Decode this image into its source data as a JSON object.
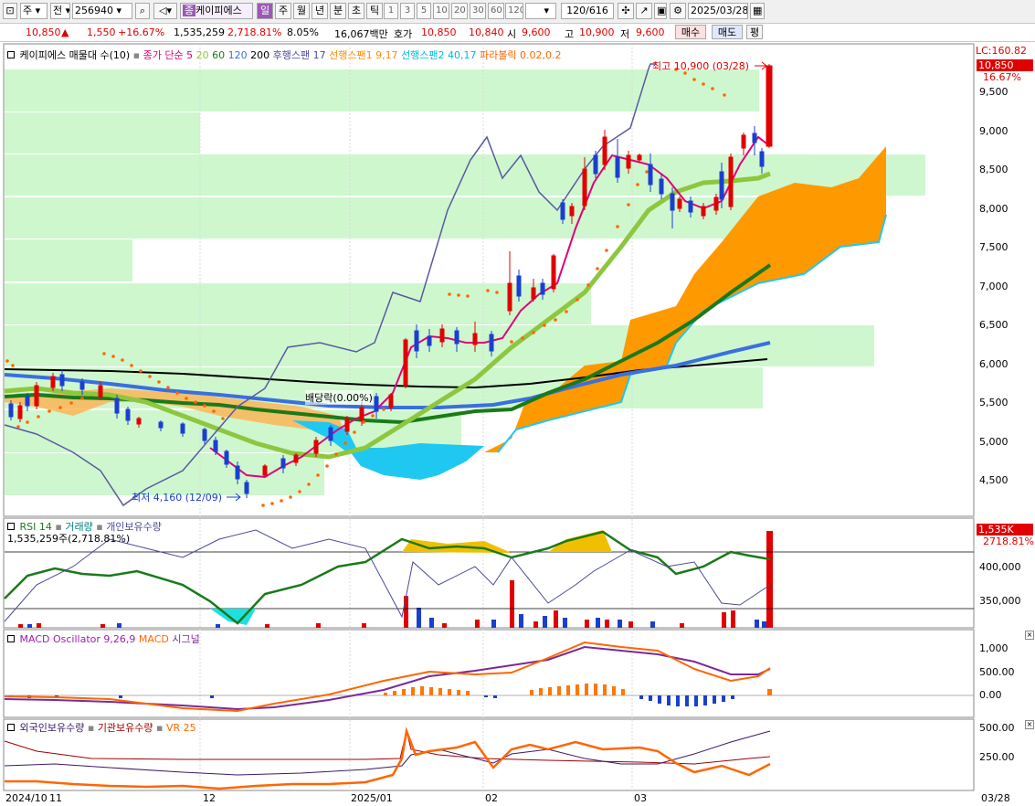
{
  "toolbar": {
    "market": "주",
    "prev": "전",
    "code": "256940",
    "name": "케이피에스",
    "periods": [
      "일",
      "주",
      "월",
      "년",
      "분",
      "초",
      "틱"
    ],
    "selected_period": "일",
    "numbers": [
      "1",
      "3",
      "5",
      "10",
      "20",
      "30",
      "60",
      "120"
    ],
    "count": "120/616",
    "date": "2025/03/28"
  },
  "infobar": {
    "price": "10,850",
    "change": "1,550",
    "rate": "+16.67%",
    "volume": "1,535,259",
    "vol_rate": "2,718.81%",
    "turnover": "8.05%",
    "amount": "16,067백만",
    "hoga_label": "호가",
    "ask": "10,850",
    "bid": "10,840",
    "open_label": "시",
    "open": "9,600",
    "high_label": "고",
    "high": "10,900",
    "low_label": "저",
    "low": "9,600",
    "buy": "매수",
    "sell": "매도",
    "eval": "평"
  },
  "price_panel": {
    "legend": [
      {
        "text": "케이피에스 매물대 수(10)",
        "color": "#000000"
      },
      {
        "text": "종가 단순 5",
        "color": "#e0007c"
      },
      {
        "text": "20",
        "color": "#8ec63f"
      },
      {
        "text": "60",
        "color": "#1a7a1a"
      },
      {
        "text": "120",
        "color": "#3a6fe0"
      },
      {
        "text": "200",
        "color": "#000000"
      },
      {
        "text": "후행스팬 17",
        "color": "#4a4a9a"
      },
      {
        "text": "선행스팬1 9,17",
        "color": "#ff8c00"
      },
      {
        "text": "선행스팬2 40,17",
        "color": "#00b8e0"
      },
      {
        "text": "파라볼릭 0.02,0.2",
        "color": "#ff6600"
      }
    ],
    "y_ticks": [
      "9,500",
      "9,000",
      "8,500",
      "8,000",
      "7,500",
      "7,000",
      "6,500",
      "6,000",
      "5,500",
      "5,000",
      "4,500"
    ],
    "lc_label": "LC:160.82",
    "price_tag": "10,850",
    "pct_tag": "16.67%",
    "high_note": "최고 10,900 (03/28)",
    "low_note": "최저 4,160 (12/09)",
    "dividend_note": "배당락(0.00%)"
  },
  "volume_panel": {
    "legend": [
      "RSI 14",
      "거래량",
      "개인보유수량"
    ],
    "legend_colors": [
      "#1a7a1a",
      "#008080",
      "#4a4a9a"
    ],
    "info": "1,535,259주(2,718.81%)",
    "tag": "1,535K",
    "tag2": "2718.81%",
    "y_ticks": [
      "400,000",
      "350,000"
    ]
  },
  "macd_panel": {
    "legend": [
      "MACD Oscillator 9,26,9",
      "MACD",
      "시그널"
    ],
    "legend_colors": [
      "#9b1fa8",
      "#ff6600",
      "#7b2a9a"
    ],
    "y_ticks": [
      "1,000",
      "500.00",
      "0.00"
    ]
  },
  "foreign_panel": {
    "legend": [
      "외국인보유수량",
      "기관보유수량",
      "VR 25"
    ],
    "legend_colors": [
      "#3a1a6a",
      "#a00000",
      "#ff6600"
    ],
    "y_ticks": [
      "500.00",
      "250.00"
    ]
  },
  "x_axis": {
    "labels": [
      "2024/10",
      "11",
      "12",
      "2025/01",
      "02",
      "03"
    ],
    "last": "03/28"
  }
}
